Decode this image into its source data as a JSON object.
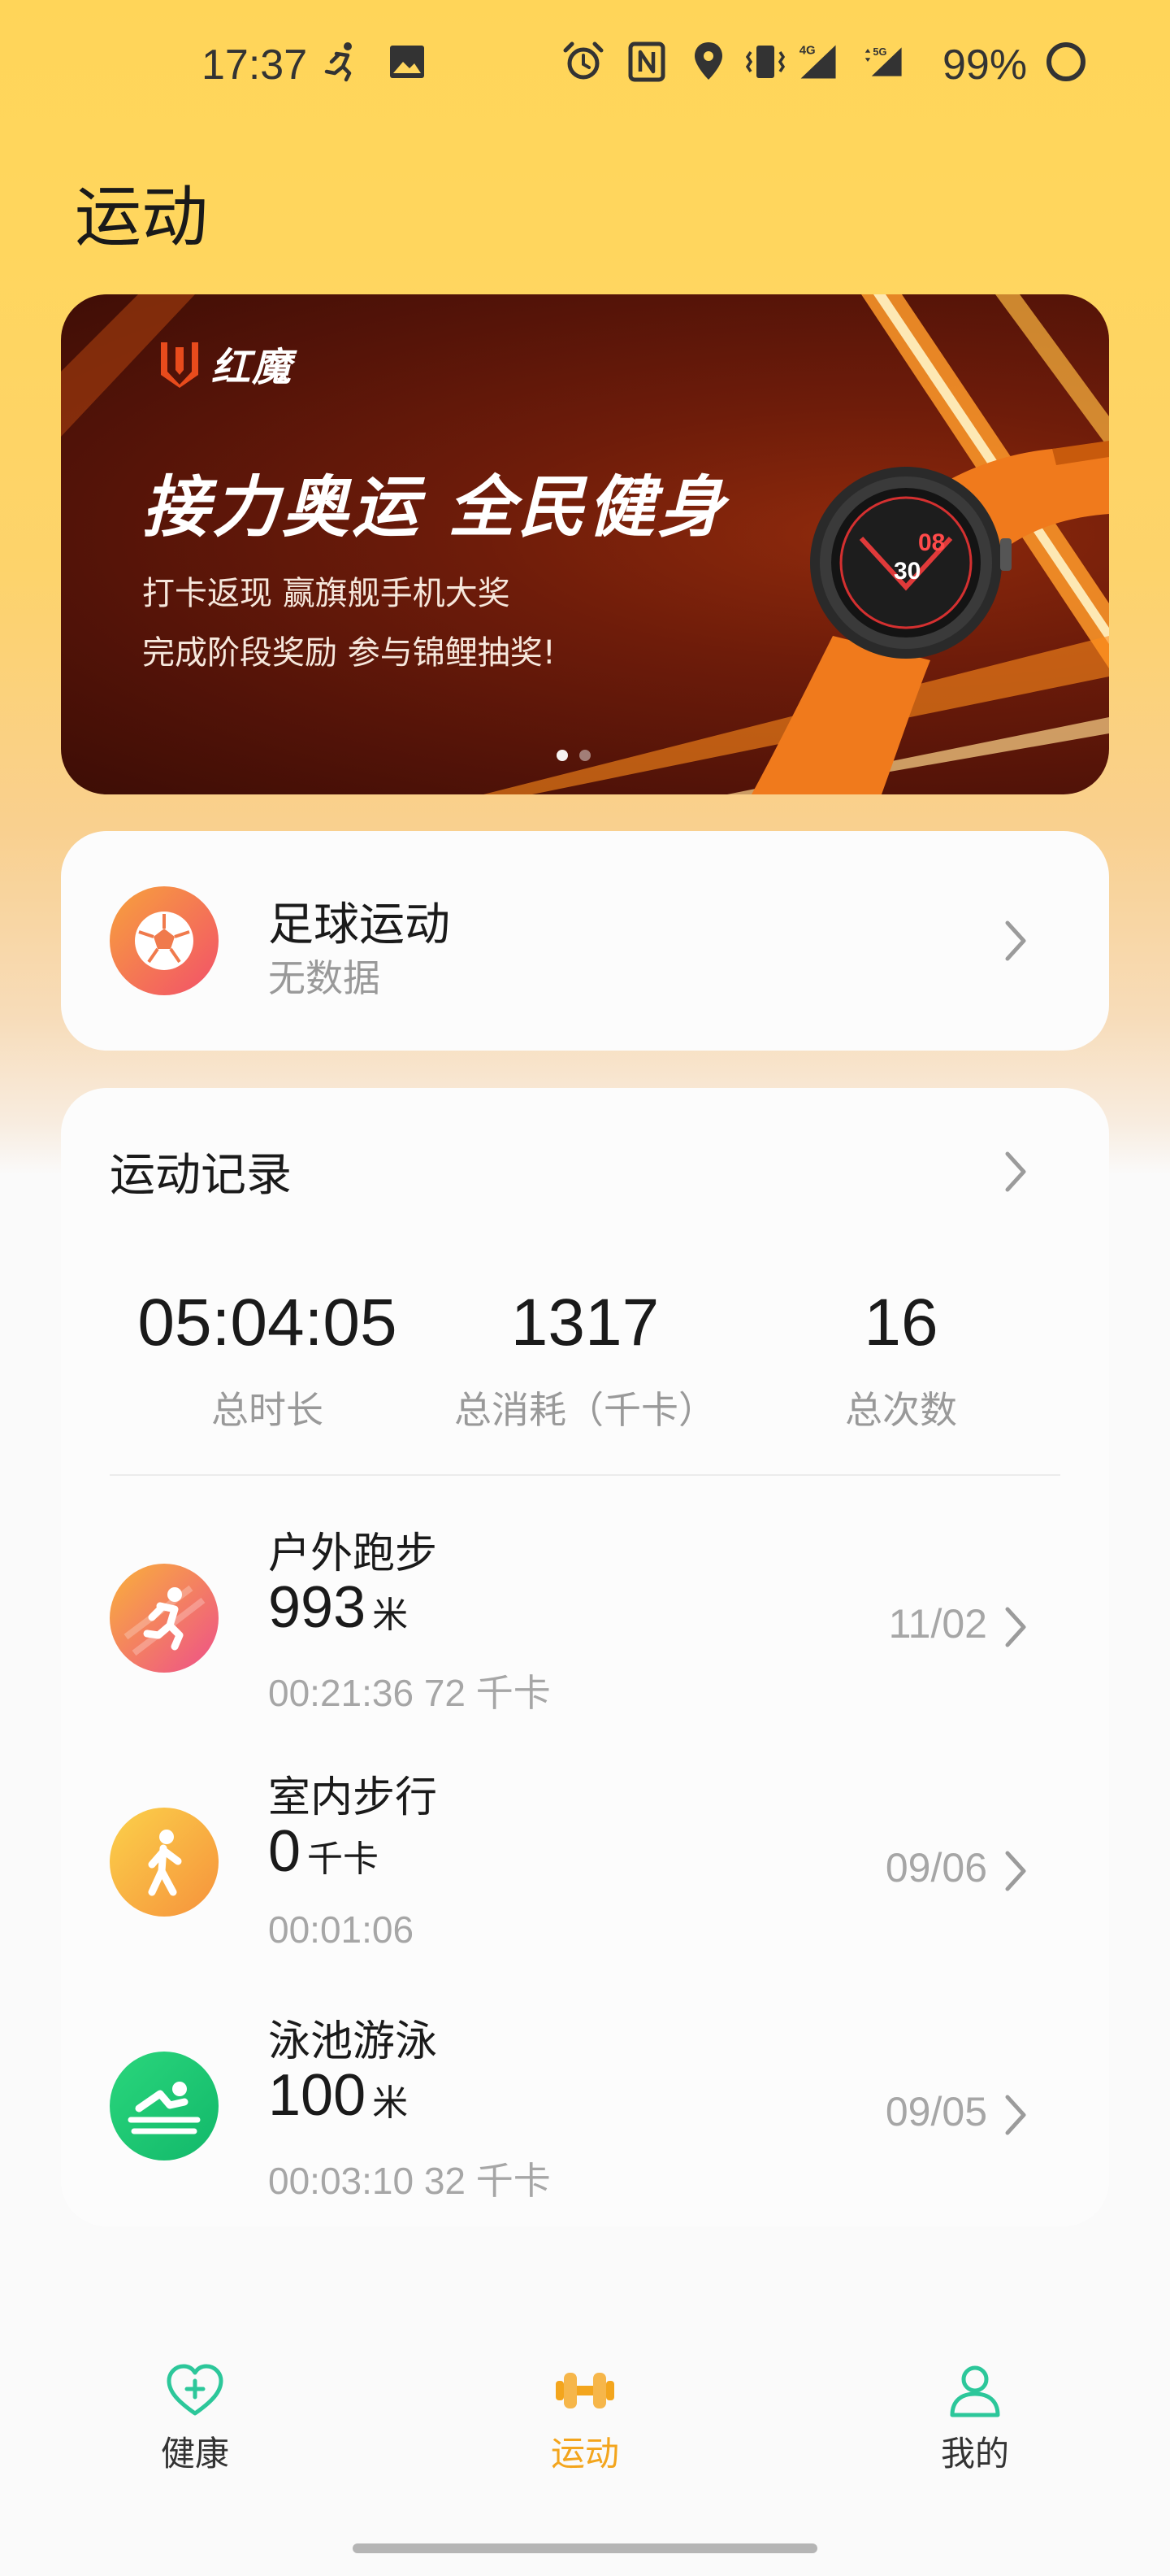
{
  "status_bar": {
    "time": "17:37",
    "battery": "99%",
    "icons": [
      "running-notification-icon",
      "image-notification-icon",
      "alarm-icon",
      "nfc-icon",
      "location-icon",
      "vibrate-icon",
      "signal-4g-icon",
      "signal-5g-icon",
      "battery-icon"
    ],
    "network_4g": "4G",
    "network_5g": "5G"
  },
  "page": {
    "title": "运动"
  },
  "banner": {
    "brand": "红魔",
    "headline": "接力奥运 全民健身",
    "line1": "打卡返现 赢旗舰手机大奖",
    "line2": "完成阶段奖励 参与锦鲤抽奖!",
    "watch_time_hour": "08",
    "watch_time_minute": "30",
    "active_dot": 0,
    "dot_count": 2
  },
  "soccer": {
    "title": "足球运动",
    "subtitle": "无数据",
    "icon": "soccer-ball-icon"
  },
  "records": {
    "title": "运动记录",
    "stats": [
      {
        "value": "05:04:05",
        "label": "总时长"
      },
      {
        "value": "1317",
        "label": "总消耗（千卡）"
      },
      {
        "value": "16",
        "label": "总次数"
      }
    ],
    "activities": [
      {
        "name": "户外跑步",
        "value": "993",
        "unit": "米",
        "sub": "00:21:36   72 千卡",
        "date": "11/02",
        "icon": "running-icon"
      },
      {
        "name": "室内步行",
        "value": "0",
        "unit": "千卡",
        "sub": "00:01:06",
        "date": "09/06",
        "icon": "walking-icon"
      },
      {
        "name": "泳池游泳",
        "value": "100",
        "unit": "米",
        "sub": "00:03:10   32 千卡",
        "date": "09/05",
        "icon": "swimming-icon"
      }
    ]
  },
  "bottom_nav": {
    "items": [
      {
        "label": "健康",
        "icon": "heart-plus-icon",
        "active": false
      },
      {
        "label": "运动",
        "icon": "dumbbell-icon",
        "active": true
      },
      {
        "label": "我的",
        "icon": "user-icon",
        "active": false
      }
    ]
  },
  "colors": {
    "accent": "#f3a51d",
    "health_green": "#2cc79a",
    "header_yellow": "#ffd559",
    "banner_dark": "#531308",
    "banner_orange": "#f07a1c"
  }
}
